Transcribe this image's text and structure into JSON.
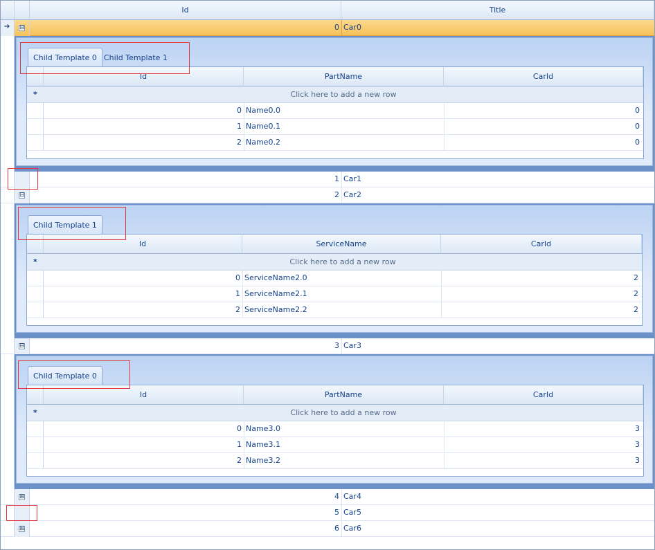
{
  "grid": {
    "columns": [
      "Id",
      "Title"
    ],
    "rows": [
      {
        "id": "0",
        "title": "Car0"
      },
      {
        "id": "1",
        "title": "Car1"
      },
      {
        "id": "2",
        "title": "Car2"
      },
      {
        "id": "3",
        "title": "Car3"
      },
      {
        "id": "4",
        "title": "Car4"
      },
      {
        "id": "5",
        "title": "Car5"
      },
      {
        "id": "6",
        "title": "Car6"
      }
    ],
    "expand_glyph": "⊞",
    "collapse_glyph": "⊟",
    "current_row_glyph": "➔",
    "new_row_glyph": "*",
    "new_row_text": "Click here to add a new row"
  },
  "details": [
    {
      "tabs": [
        "Child Template 0",
        "Child Template 1"
      ],
      "columns": [
        "Id",
        "PartName",
        "CarId"
      ],
      "rows": [
        [
          "0",
          "Name0.0",
          "0"
        ],
        [
          "1",
          "Name0.1",
          "0"
        ],
        [
          "2",
          "Name0.2",
          "0"
        ]
      ]
    },
    {
      "tabs": [
        "Child Template 1"
      ],
      "columns": [
        "Id",
        "ServiceName",
        "CarId"
      ],
      "rows": [
        [
          "0",
          "ServiceName2.0",
          "2"
        ],
        [
          "1",
          "ServiceName2.1",
          "2"
        ],
        [
          "2",
          "ServiceName2.2",
          "2"
        ]
      ]
    },
    {
      "tabs": [
        "Child Template 0"
      ],
      "columns": [
        "Id",
        "PartName",
        "CarId"
      ],
      "rows": [
        [
          "0",
          "Name3.0",
          "3"
        ],
        [
          "1",
          "Name3.1",
          "3"
        ],
        [
          "2",
          "Name3.2",
          "3"
        ]
      ]
    }
  ],
  "colors": {
    "selected_row": "#f6c25a",
    "annotation_box": "#e0383e",
    "detail_border": "#6b91c8"
  }
}
